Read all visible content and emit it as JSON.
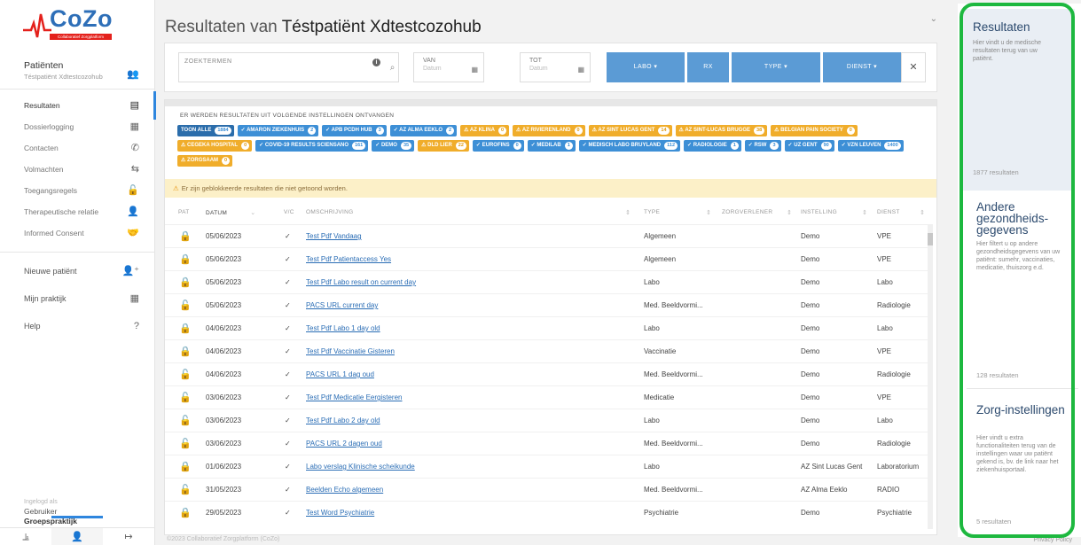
{
  "app": {
    "logo": "CoZo",
    "logo_sub": "Collaboratief Zorgplatform",
    "title_prefix": "Resultaten van",
    "patient_name": "Téstpatiënt Xdtestcozohub"
  },
  "sidebar": {
    "patient_label": "Patiënten",
    "patient_sub": "Téstpatiënt Xdtestcozohub",
    "items": [
      {
        "label": "Resultaten",
        "icon": "document-icon"
      },
      {
        "label": "Dossierlogging",
        "icon": "logging-icon"
      },
      {
        "label": "Contacten",
        "icon": "contacts-icon"
      },
      {
        "label": "Volmachten",
        "icon": "mandate-icon"
      },
      {
        "label": "Toegangsregels",
        "icon": "lock-icon"
      },
      {
        "label": "Therapeutische relatie",
        "icon": "user-icon"
      },
      {
        "label": "Informed Consent",
        "icon": "handshake-icon"
      }
    ],
    "items2": [
      {
        "label": "Nieuwe patiënt",
        "icon": "add-user-icon"
      },
      {
        "label": "Mijn praktijk",
        "icon": "practice-icon"
      },
      {
        "label": "Help",
        "icon": "help-icon"
      }
    ],
    "login_label": "Ingelogd als",
    "login_user": "Gebruiker",
    "login_practice": "Groepspraktijk"
  },
  "filters": {
    "search_label": "ZOEKTERMEN",
    "from_label": "VAN",
    "from_placeholder": "Datum",
    "to_label": "TOT",
    "to_placeholder": "Datum",
    "labo": "LABO ▾",
    "rx": "RX",
    "type": "TYPE ▾",
    "dienst": "DIENST ▾"
  },
  "sources": {
    "title": "ER WERDEN RESULTATEN UIT VOLGENDE INSTELLINGEN ONTVANGEN",
    "chips": [
      {
        "label": "TOON ALLE",
        "count": "1884",
        "kind": "all"
      },
      {
        "label": "✓ AMARON ZIEKENHUIS",
        "count": "2",
        "kind": "ok"
      },
      {
        "label": "✓ APB PCDH HUB",
        "count": "3",
        "kind": "ok"
      },
      {
        "label": "✓ AZ ALMA EEKLO",
        "count": "2",
        "kind": "ok"
      },
      {
        "label": "⚠ AZ KLINA",
        "count": "0",
        "kind": "warn"
      },
      {
        "label": "⚠ AZ RIVIERENLAND",
        "count": "0",
        "kind": "warn"
      },
      {
        "label": "⚠ AZ SINT LUCAS GENT",
        "count": "14",
        "kind": "warn"
      },
      {
        "label": "⚠ AZ SINT-LUCAS BRUGGE",
        "count": "38",
        "kind": "warn"
      },
      {
        "label": "⚠ BELGIAN PAIN SOCIETY",
        "count": "0",
        "kind": "warn"
      },
      {
        "label": "⚠ CEGEKA HOSPITAL",
        "count": "0",
        "kind": "warn"
      },
      {
        "label": "✓ COVID-19 RESULTS SCIENSANO",
        "count": "161",
        "kind": "ok"
      },
      {
        "label": "✓ DEMO",
        "count": "35",
        "kind": "ok"
      },
      {
        "label": "⚠ DLD LIER",
        "count": "22",
        "kind": "warn"
      },
      {
        "label": "✓ EUROFINS",
        "count": "0",
        "kind": "ok"
      },
      {
        "label": "✓ MEDILAB",
        "count": "1",
        "kind": "ok"
      },
      {
        "label": "✓ MEDISCH LABO BRUYLAND",
        "count": "112",
        "kind": "ok"
      },
      {
        "label": "✓ RADIOLOGIE",
        "count": "1",
        "kind": "ok"
      },
      {
        "label": "✓ RSW",
        "count": "3",
        "kind": "ok"
      },
      {
        "label": "✓ UZ GENT",
        "count": "90",
        "kind": "ok"
      },
      {
        "label": "✓ VZN LEUVEN",
        "count": "1400",
        "kind": "ok"
      },
      {
        "label": "⚠ ZORGSAAM",
        "count": "0",
        "kind": "warn"
      }
    ]
  },
  "warning": "Er zijn geblokkeerde resultaten die niet getoond worden.",
  "table": {
    "headers": {
      "pat": "PAT",
      "datum": "DATUM",
      "vc": "V/C",
      "omschrijving": "OMSCHRIJVING",
      "type": "TYPE",
      "zorgverlener": "ZORGVERLENER",
      "instelling": "INSTELLING",
      "dienst": "DIENST"
    },
    "rows": [
      {
        "lock": "closed",
        "date": "05/06/2023",
        "desc": "Test Pdf Vandaag",
        "type": "Algemeen",
        "inst": "Demo",
        "dienst": "VPE"
      },
      {
        "lock": "closed",
        "date": "05/06/2023",
        "desc": "Test Pdf Patientaccess Yes",
        "type": "Algemeen",
        "inst": "Demo",
        "dienst": "VPE"
      },
      {
        "lock": "closed",
        "date": "05/06/2023",
        "desc": "Test Pdf Labo result on current day",
        "type": "Labo",
        "inst": "Demo",
        "dienst": "Labo"
      },
      {
        "lock": "open",
        "date": "05/06/2023",
        "desc": "PACS URL current day",
        "type": "Med. Beeldvormi...",
        "inst": "Demo",
        "dienst": "Radiologie"
      },
      {
        "lock": "closed",
        "date": "04/06/2023",
        "desc": "Test Pdf Labo 1 day old",
        "type": "Labo",
        "inst": "Demo",
        "dienst": "Labo"
      },
      {
        "lock": "closed",
        "date": "04/06/2023",
        "desc": "Test Pdf Vaccinatie Gisteren",
        "type": "Vaccinatie",
        "inst": "Demo",
        "dienst": "VPE"
      },
      {
        "lock": "open",
        "date": "04/06/2023",
        "desc": "PACS URL 1 dag oud",
        "type": "Med. Beeldvormi...",
        "inst": "Demo",
        "dienst": "Radiologie"
      },
      {
        "lock": "open",
        "date": "03/06/2023",
        "desc": "Test Pdf Medicatie Eergisteren",
        "type": "Medicatie",
        "inst": "Demo",
        "dienst": "VPE"
      },
      {
        "lock": "open",
        "date": "03/06/2023",
        "desc": "Test Pdf Labo 2 day old",
        "type": "Labo",
        "inst": "Demo",
        "dienst": "Labo"
      },
      {
        "lock": "open",
        "date": "03/06/2023",
        "desc": "PACS URL 2 dagen oud",
        "type": "Med. Beeldvormi...",
        "inst": "Demo",
        "dienst": "Radiologie"
      },
      {
        "lock": "closed",
        "date": "01/06/2023",
        "desc": "Labo verslag Klinische scheikunde",
        "type": "Labo",
        "inst": "AZ Sint Lucas Gent",
        "dienst": "Laboratorium"
      },
      {
        "lock": "open",
        "date": "31/05/2023",
        "desc": "Beelden Echo algemeen",
        "type": "Med. Beeldvormi...",
        "inst": "AZ Alma Eeklo",
        "dienst": "RADIO"
      },
      {
        "lock": "closed",
        "date": "29/05/2023",
        "desc": "Test Word Psychiatrie",
        "type": "Psychiatrie",
        "inst": "Demo",
        "dienst": "Psychiatrie"
      }
    ]
  },
  "footer": "©2023 Collaboratief Zorgplatform (CoZo)",
  "privacy": "Privacy Policy",
  "panel": [
    {
      "title": "Resultaten",
      "desc": "Hier vindt u de medische resultaten terug van uw patiënt.",
      "count": "1877 resultaten"
    },
    {
      "title": "Andere gezondheids-gegevens",
      "desc": "Hier filtert u op andere gezondheidsgegevens van uw patiënt: sumehr, vaccinaties, medicatie, thuiszorg e.d.",
      "count": "128 resultaten"
    },
    {
      "title": "Zorg-instellingen",
      "desc": "Hier vindt u extra functionaliteiten terug van de instellingen waar uw patiënt gekend is, bv. de link naar het ziekenhuisportaal.",
      "count": "5 resultaten"
    }
  ],
  "colors": {
    "accent": "#2e86de",
    "button": "#5b9bd5",
    "highlight_ring": "#1db83f",
    "warning": "#f0ad2b"
  }
}
